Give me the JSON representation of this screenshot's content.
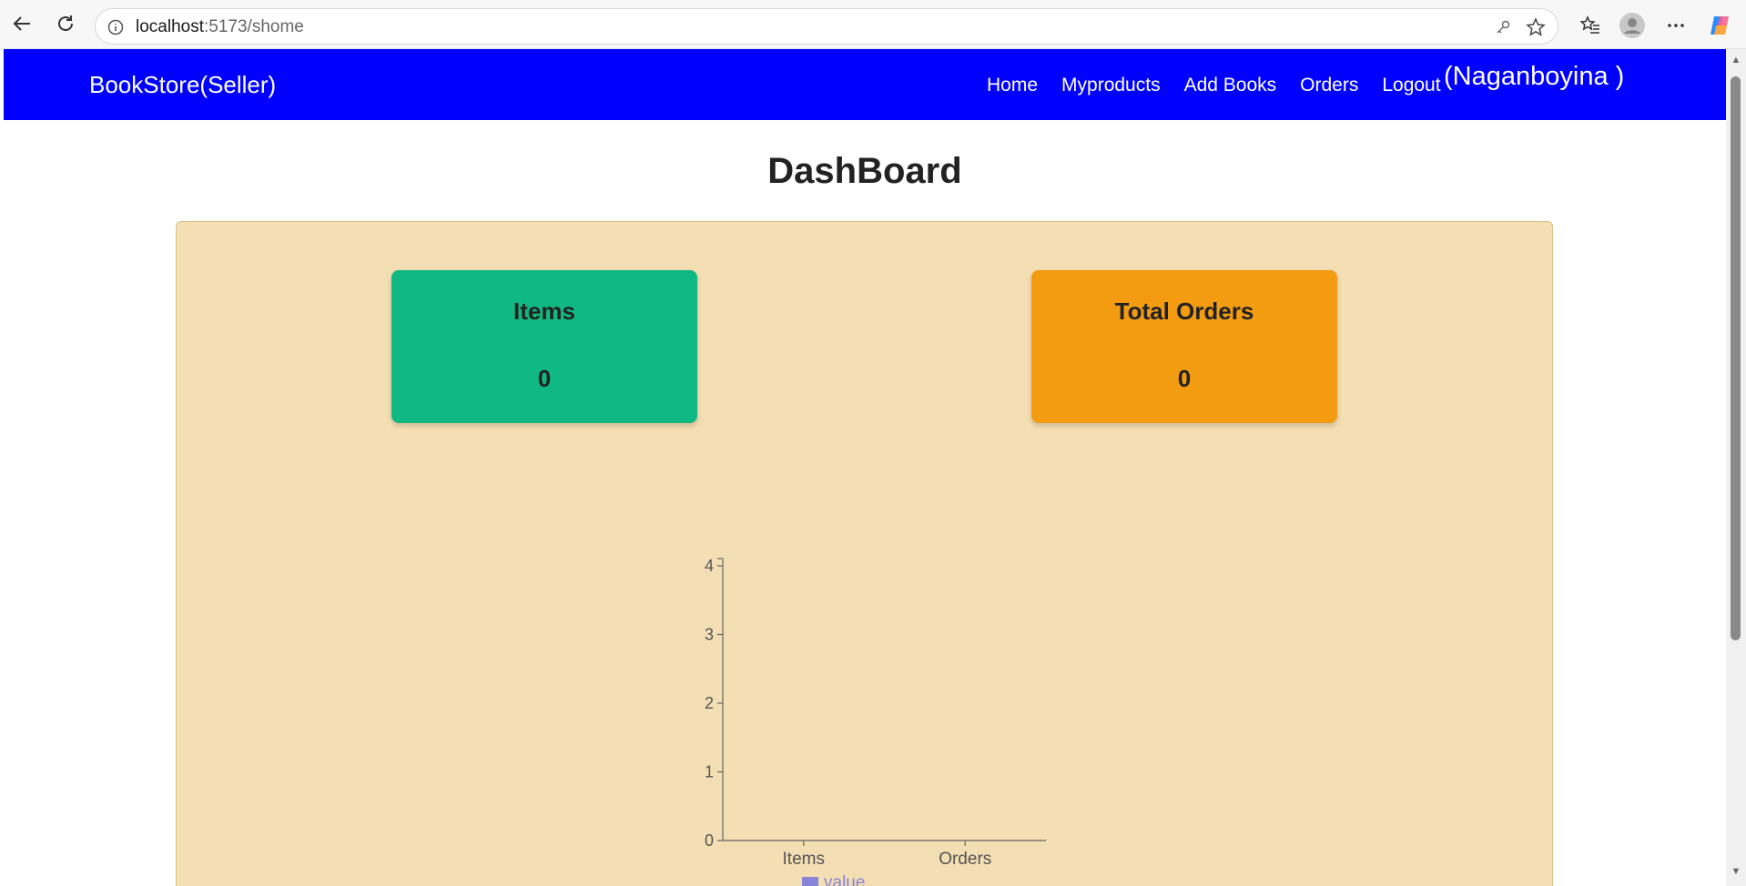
{
  "browser": {
    "url_host": "localhost",
    "url_port_path": ":5173/shome"
  },
  "nav": {
    "brand": "BookStore(Seller)",
    "links": [
      "Home",
      "Myproducts",
      "Add Books",
      "Orders",
      "Logout"
    ],
    "username": "(Naganboyina )"
  },
  "page": {
    "title": "DashBoard"
  },
  "cards": {
    "items": {
      "label": "Items",
      "value": "0",
      "color": "#10b981"
    },
    "orders": {
      "label": "Total Orders",
      "value": "0",
      "color": "#f39c12"
    }
  },
  "chart_data": {
    "type": "bar",
    "categories": [
      "Items",
      "Orders"
    ],
    "series": [
      {
        "name": "value",
        "values": [
          0,
          0
        ],
        "color": "#8884d8"
      }
    ],
    "yticks": [
      0,
      1,
      2,
      3,
      4
    ],
    "ylim": [
      0,
      4
    ],
    "legend_position": "bottom",
    "grid": false
  }
}
